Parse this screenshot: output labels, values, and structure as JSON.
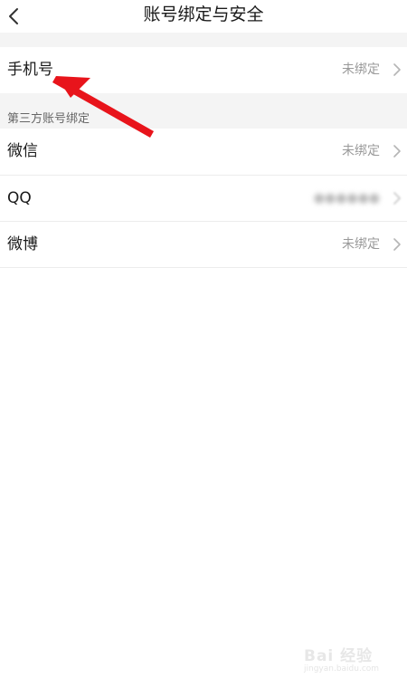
{
  "header": {
    "title": "账号绑定与安全",
    "back_icon": "chevron-left-icon"
  },
  "phone": {
    "label": "手机号",
    "value": "未绑定"
  },
  "third_party": {
    "section_title": "第三方账号绑定",
    "items": [
      {
        "label": "微信",
        "value": "未绑定"
      },
      {
        "label": "QQ",
        "value": "●●●●●●"
      },
      {
        "label": "微博",
        "value": "未绑定"
      }
    ]
  },
  "watermark": {
    "text": "Bai 经验",
    "url": "jingyan.baidu.com"
  },
  "colors": {
    "background": "#ffffff",
    "section_background": "#f4f4f4",
    "label_text": "#1a1a1a",
    "value_text": "#999999",
    "annotation_arrow": "#e8141b"
  }
}
